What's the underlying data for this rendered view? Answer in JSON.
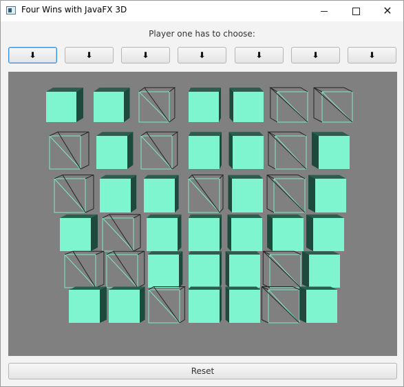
{
  "window": {
    "title": "Four Wins with JavaFX 3D",
    "controls": [
      "minimize",
      "maximize",
      "close"
    ]
  },
  "prompt": "Player one has to choose:",
  "drop_buttons": [
    {
      "label": "⬇",
      "focused": true
    },
    {
      "label": "⬇",
      "focused": false
    },
    {
      "label": "⬇",
      "focused": false
    },
    {
      "label": "⬇",
      "focused": false
    },
    {
      "label": "⬇",
      "focused": false
    },
    {
      "label": "⬇",
      "focused": false
    },
    {
      "label": "⬇",
      "focused": false
    }
  ],
  "board": {
    "columns": 7,
    "rows": 6,
    "cells": [
      [
        "filled",
        "filled",
        "empty",
        "filled",
        "filled",
        "empty",
        "empty"
      ],
      [
        "empty",
        "filled",
        "empty",
        "filled",
        "filled",
        "empty",
        "filled"
      ],
      [
        "empty",
        "filled",
        "filled",
        "empty",
        "filled",
        "empty",
        "filled"
      ],
      [
        "filled",
        "empty",
        "filled",
        "filled",
        "filled",
        "filled",
        "filled"
      ],
      [
        "empty",
        "empty",
        "filled",
        "filled",
        "filled",
        "empty",
        "filled"
      ],
      [
        "filled",
        "filled",
        "empty",
        "filled",
        "filled",
        "empty",
        "filled"
      ]
    ],
    "colors": {
      "background": "#808080",
      "front": "#7ff5cf",
      "side": "#1d4a3d",
      "top": "#2a5f4e",
      "wire_light": "#7fe8c8",
      "wire_dark": "#222222"
    }
  },
  "reset_label": "Reset"
}
